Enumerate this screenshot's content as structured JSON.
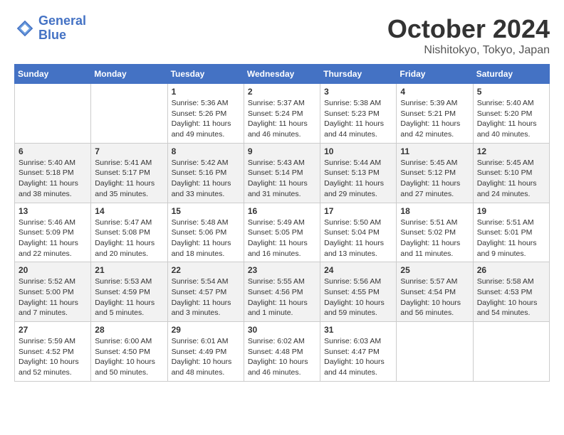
{
  "header": {
    "logo_line1": "General",
    "logo_line2": "Blue",
    "month": "October 2024",
    "location": "Nishitokyo, Tokyo, Japan"
  },
  "days_of_week": [
    "Sunday",
    "Monday",
    "Tuesday",
    "Wednesday",
    "Thursday",
    "Friday",
    "Saturday"
  ],
  "weeks": [
    [
      {
        "day": "",
        "info": ""
      },
      {
        "day": "",
        "info": ""
      },
      {
        "day": "1",
        "info": "Sunrise: 5:36 AM\nSunset: 5:26 PM\nDaylight: 11 hours and 49 minutes."
      },
      {
        "day": "2",
        "info": "Sunrise: 5:37 AM\nSunset: 5:24 PM\nDaylight: 11 hours and 46 minutes."
      },
      {
        "day": "3",
        "info": "Sunrise: 5:38 AM\nSunset: 5:23 PM\nDaylight: 11 hours and 44 minutes."
      },
      {
        "day": "4",
        "info": "Sunrise: 5:39 AM\nSunset: 5:21 PM\nDaylight: 11 hours and 42 minutes."
      },
      {
        "day": "5",
        "info": "Sunrise: 5:40 AM\nSunset: 5:20 PM\nDaylight: 11 hours and 40 minutes."
      }
    ],
    [
      {
        "day": "6",
        "info": "Sunrise: 5:40 AM\nSunset: 5:18 PM\nDaylight: 11 hours and 38 minutes."
      },
      {
        "day": "7",
        "info": "Sunrise: 5:41 AM\nSunset: 5:17 PM\nDaylight: 11 hours and 35 minutes."
      },
      {
        "day": "8",
        "info": "Sunrise: 5:42 AM\nSunset: 5:16 PM\nDaylight: 11 hours and 33 minutes."
      },
      {
        "day": "9",
        "info": "Sunrise: 5:43 AM\nSunset: 5:14 PM\nDaylight: 11 hours and 31 minutes."
      },
      {
        "day": "10",
        "info": "Sunrise: 5:44 AM\nSunset: 5:13 PM\nDaylight: 11 hours and 29 minutes."
      },
      {
        "day": "11",
        "info": "Sunrise: 5:45 AM\nSunset: 5:12 PM\nDaylight: 11 hours and 27 minutes."
      },
      {
        "day": "12",
        "info": "Sunrise: 5:45 AM\nSunset: 5:10 PM\nDaylight: 11 hours and 24 minutes."
      }
    ],
    [
      {
        "day": "13",
        "info": "Sunrise: 5:46 AM\nSunset: 5:09 PM\nDaylight: 11 hours and 22 minutes."
      },
      {
        "day": "14",
        "info": "Sunrise: 5:47 AM\nSunset: 5:08 PM\nDaylight: 11 hours and 20 minutes."
      },
      {
        "day": "15",
        "info": "Sunrise: 5:48 AM\nSunset: 5:06 PM\nDaylight: 11 hours and 18 minutes."
      },
      {
        "day": "16",
        "info": "Sunrise: 5:49 AM\nSunset: 5:05 PM\nDaylight: 11 hours and 16 minutes."
      },
      {
        "day": "17",
        "info": "Sunrise: 5:50 AM\nSunset: 5:04 PM\nDaylight: 11 hours and 13 minutes."
      },
      {
        "day": "18",
        "info": "Sunrise: 5:51 AM\nSunset: 5:02 PM\nDaylight: 11 hours and 11 minutes."
      },
      {
        "day": "19",
        "info": "Sunrise: 5:51 AM\nSunset: 5:01 PM\nDaylight: 11 hours and 9 minutes."
      }
    ],
    [
      {
        "day": "20",
        "info": "Sunrise: 5:52 AM\nSunset: 5:00 PM\nDaylight: 11 hours and 7 minutes."
      },
      {
        "day": "21",
        "info": "Sunrise: 5:53 AM\nSunset: 4:59 PM\nDaylight: 11 hours and 5 minutes."
      },
      {
        "day": "22",
        "info": "Sunrise: 5:54 AM\nSunset: 4:57 PM\nDaylight: 11 hours and 3 minutes."
      },
      {
        "day": "23",
        "info": "Sunrise: 5:55 AM\nSunset: 4:56 PM\nDaylight: 11 hours and 1 minute."
      },
      {
        "day": "24",
        "info": "Sunrise: 5:56 AM\nSunset: 4:55 PM\nDaylight: 10 hours and 59 minutes."
      },
      {
        "day": "25",
        "info": "Sunrise: 5:57 AM\nSunset: 4:54 PM\nDaylight: 10 hours and 56 minutes."
      },
      {
        "day": "26",
        "info": "Sunrise: 5:58 AM\nSunset: 4:53 PM\nDaylight: 10 hours and 54 minutes."
      }
    ],
    [
      {
        "day": "27",
        "info": "Sunrise: 5:59 AM\nSunset: 4:52 PM\nDaylight: 10 hours and 52 minutes."
      },
      {
        "day": "28",
        "info": "Sunrise: 6:00 AM\nSunset: 4:50 PM\nDaylight: 10 hours and 50 minutes."
      },
      {
        "day": "29",
        "info": "Sunrise: 6:01 AM\nSunset: 4:49 PM\nDaylight: 10 hours and 48 minutes."
      },
      {
        "day": "30",
        "info": "Sunrise: 6:02 AM\nSunset: 4:48 PM\nDaylight: 10 hours and 46 minutes."
      },
      {
        "day": "31",
        "info": "Sunrise: 6:03 AM\nSunset: 4:47 PM\nDaylight: 10 hours and 44 minutes."
      },
      {
        "day": "",
        "info": ""
      },
      {
        "day": "",
        "info": ""
      }
    ]
  ]
}
